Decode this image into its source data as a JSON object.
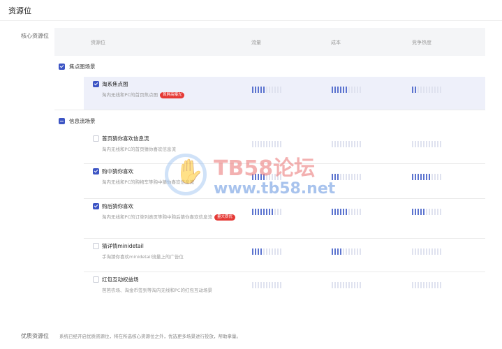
{
  "header": {
    "title": "资源位"
  },
  "core": {
    "label": "核心资源位",
    "columns": {
      "resource": "资源位",
      "traffic": "流量",
      "cost": "成本",
      "competition": "竞争热度"
    },
    "groups": [
      {
        "label": "焦点图场景",
        "state": "checked"
      },
      {
        "label": "信息流场景",
        "state": "indeterminate"
      }
    ],
    "items": [
      {
        "name": "淘系焦点图",
        "desc": "淘内无线和PC的首页焦点图",
        "badge": "首屏高曝光",
        "checked": true,
        "traffic": 0.45,
        "cost": 0.55,
        "competition": 0.15
      },
      {
        "name": "首页猜你喜欢信息流",
        "desc": "淘内无线和PC的首页猜你喜欢信息流",
        "badge": "",
        "checked": false,
        "traffic": 0.0,
        "cost": 0.0,
        "competition": 0.0
      },
      {
        "name": "购中猜你喜欢",
        "desc": "淘内无线和PC的购物车等购中猜你喜欢信息流",
        "badge": "",
        "checked": true,
        "traffic": 0.45,
        "cost": 0.3,
        "competition": 0.6
      },
      {
        "name": "购后猜你喜欢",
        "desc": "淘内无线和PC的订单列表页等购中购后猜你喜欢信息流",
        "badge": "量大质优",
        "checked": true,
        "traffic": 0.75,
        "cost": 0.55,
        "competition": 0.45
      },
      {
        "name": "猜详情minidetail",
        "desc": "手淘猜你喜欢minidetail流量上的广告位",
        "badge": "",
        "checked": false,
        "traffic": 0.4,
        "cost": 0.4,
        "competition": 0.0
      },
      {
        "name": "红包互动权益场",
        "desc": "芭芭农场、淘金币签到等淘内无线和PC的红包互动场景",
        "badge": "",
        "checked": false,
        "traffic": 0.0,
        "cost": 0.0,
        "competition": 0.0
      }
    ]
  },
  "premium": {
    "label": "优质资源位",
    "text": "系统已经开启优质资源位，将在所选核心资源位之外，优选更多场景进行投放，帮助拿量。"
  },
  "watermark": {
    "title": "TB58论坛",
    "url": "www.tb58.net"
  },
  "colors": {
    "accent": "#3d55c4",
    "badge": "#e53935",
    "bar_on": "#5b73cf",
    "bar_off": "#dfe2ef",
    "highlight": "#eef0fa"
  }
}
